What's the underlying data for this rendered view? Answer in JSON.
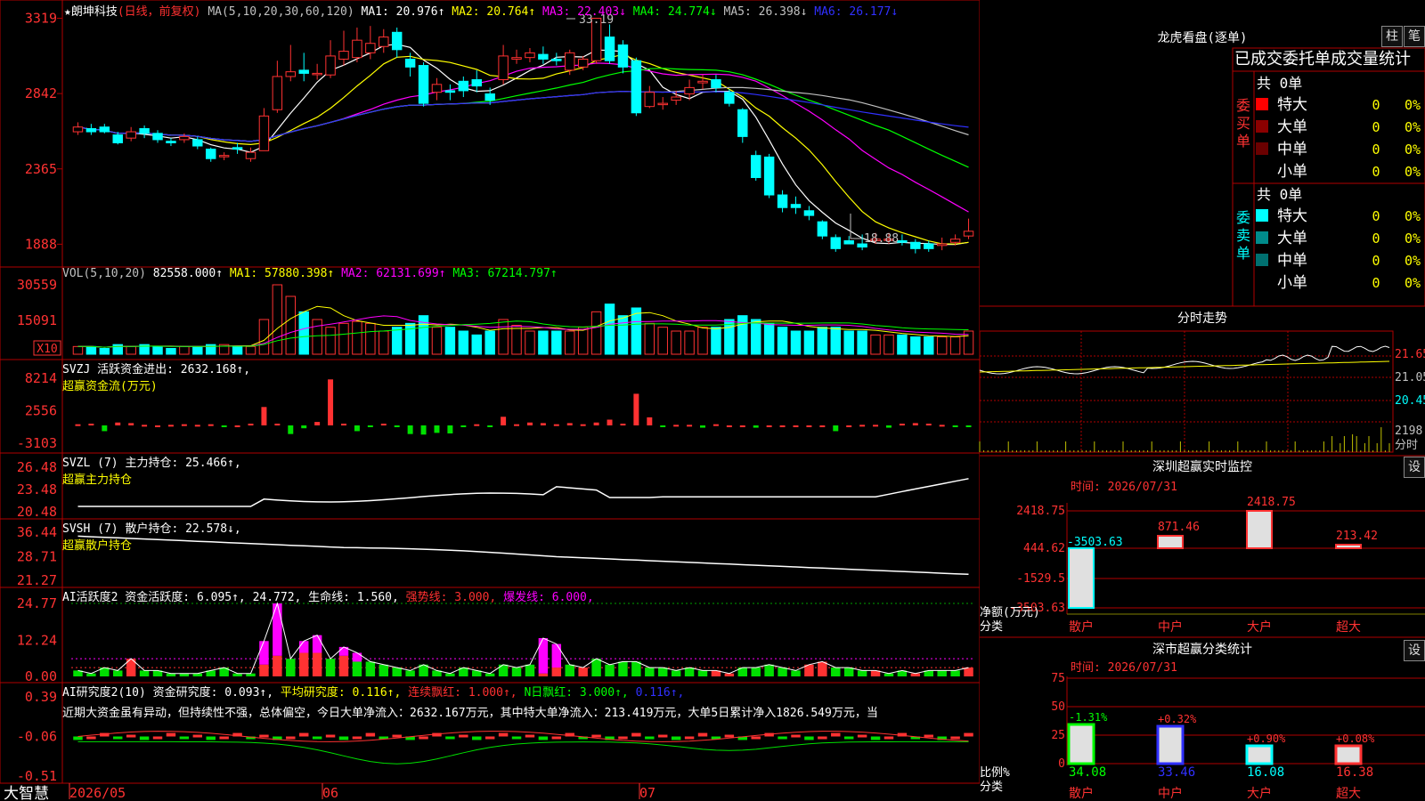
{
  "app": {
    "logo": "大智慧"
  },
  "stock_title": "★朗坤科技",
  "period": "(日线，前复权)",
  "main_ma": {
    "label": "MA(5,10,20,30,60,120)",
    "items": [
      {
        "text": "MA1: 20.976↑",
        "color": "#ffffff"
      },
      {
        "text": "MA2: 20.764↑",
        "color": "#ffff00"
      },
      {
        "text": "MA3: 22.403↓",
        "color": "#ff00ff"
      },
      {
        "text": "MA4: 24.774↓",
        "color": "#00ff00"
      },
      {
        "text": "MA5: 26.398↓",
        "color": "#c0c0c0"
      },
      {
        "text": "MA6: 26.177↓",
        "color": "#3030ff"
      }
    ]
  },
  "price_axis": [
    "3319",
    "2842",
    "2365",
    "1888"
  ],
  "annotations": {
    "high": "33.19",
    "low": "18.88"
  },
  "vol_panel": {
    "label": "VOL(5,10,20)",
    "value": "82558.000↑",
    "ma": [
      {
        "text": "MA1: 57880.398↑",
        "color": "#ffff00"
      },
      {
        "text": "MA2: 62131.699↑",
        "color": "#ff00ff"
      },
      {
        "text": "MA3: 67214.797↑",
        "color": "#00ff00"
      }
    ],
    "axis": [
      "30559",
      "15091"
    ],
    "unit": "X10"
  },
  "svzj_panel": {
    "label": "SVZJ  活跃资金进出: 2632.168↑,",
    "sub": "超赢资金流(万元)",
    "axis": [
      "8214",
      "2556",
      "-3103"
    ]
  },
  "svzl_panel": {
    "label": "SVZL (7) 主力持仓: 25.466↑,",
    "sub": "超赢主力持仓",
    "axis": [
      "26.48",
      "23.48",
      "20.48"
    ]
  },
  "svsh_panel": {
    "label": "SVSH (7) 散户持仓: 22.578↓,",
    "sub": "超赢散户持仓",
    "axis": [
      "36.44",
      "28.71",
      "21.27"
    ]
  },
  "ai_active_panel": {
    "label": "AI活跃度2 资金活跃度: 6.095↑, 24.772, 生命线: 1.560,",
    "strong": "强势线: 3.000,",
    "burst": "爆发线: 6.000,",
    "axis": [
      "24.77",
      "12.24",
      "0.00"
    ]
  },
  "ai_research_panel": {
    "label": "AI研究度2(10) 资金研究度: 0.093↑,",
    "avg": "平均研究度: 0.116↑,",
    "cont": "连续飘红: 1.000↑,",
    "nday": "N日飘红: 3.000↑,",
    "last": "0.116↑,",
    "comment": "近期大资金虽有异动，但持续性不强，总体偏空，今日大单净流入：2632.167万元，其中特大单净流入：213.419万元，大单5日累计净入1826.549万元，当",
    "axis": [
      "0.39",
      "-0.06",
      "-0.51"
    ]
  },
  "date_axis": [
    "2026/05",
    "06",
    "07"
  ],
  "right": {
    "dragon_title": "龙虎看盘(逐单)",
    "btn_bar": "柱",
    "btn_pen": "笔",
    "stats_header": "已成交委托单成交量统计",
    "buy_label": "委买单",
    "sell_label": "委卖单",
    "buy_total": "共 0单",
    "sell_total": "共 0单",
    "buy_rows": [
      {
        "name": "特大",
        "count": "0",
        "pct": "0%",
        "color": "#ff0000"
      },
      {
        "name": "大单",
        "count": "0",
        "pct": "0%",
        "color": "#8b0000"
      },
      {
        "name": "中单",
        "count": "0",
        "pct": "0%",
        "color": "#6b0000"
      },
      {
        "name": "小单",
        "count": "0",
        "pct": "0%",
        "color": ""
      }
    ],
    "sell_rows": [
      {
        "name": "特大",
        "count": "0",
        "pct": "0%",
        "color": "#00ffff"
      },
      {
        "name": "大单",
        "count": "0",
        "pct": "0%",
        "color": "#008b8b"
      },
      {
        "name": "中单",
        "count": "0",
        "pct": "0%",
        "color": "#007070"
      },
      {
        "name": "小单",
        "count": "0",
        "pct": "0%",
        "color": ""
      }
    ],
    "intraday_title": "分时走势",
    "intraday_axis": [
      "21.65",
      "21.05",
      "20.45"
    ],
    "intraday_vol": "2198",
    "intraday_vol_label": "分时",
    "sz_title": "深圳超赢实时监控",
    "sz_time": "时间: 2026/07/31",
    "sz_axis": [
      "2418.75",
      "444.62",
      "-1529.5",
      "-3503.63"
    ],
    "sz_bar_values": [
      "-3503.63",
      "871.46",
      "2418.75",
      "213.42"
    ],
    "sz_ylabel_1": "净额(万元)",
    "sz_ylabel_2": "分类",
    "sz_categories": [
      "散户",
      "中户",
      "大户",
      "超大"
    ],
    "sm_title": "深市超赢分类统计",
    "sm_time": "时间: 2026/07/31",
    "sm_axis": [
      "75",
      "50",
      "25",
      "0"
    ],
    "sm_changes": [
      "-1.31%",
      "+0.32%",
      "+0.90%",
      "+0.08%"
    ],
    "sm_values": [
      "34.08",
      "33.46",
      "16.08",
      "16.38"
    ],
    "sm_ylabel_1": "比例%",
    "sm_ylabel_2": "分类",
    "sm_categories": [
      "散户",
      "中户",
      "大户",
      "超大"
    ],
    "btn_settings": "设"
  },
  "chart_data": {
    "type": "candlestick",
    "price_scale": {
      "ylim": [
        18.0,
        33.5
      ]
    },
    "candles": [
      [
        26.0,
        26.3,
        26.6,
        25.8
      ],
      [
        26.2,
        26.0,
        26.5,
        25.8
      ],
      [
        26.3,
        26.0,
        26.5,
        25.9
      ],
      [
        25.8,
        25.3,
        26.0,
        25.2
      ],
      [
        25.6,
        26.0,
        26.3,
        25.4
      ],
      [
        26.2,
        25.9,
        26.4,
        25.6
      ],
      [
        25.9,
        25.5,
        26.1,
        25.3
      ],
      [
        25.4,
        25.3,
        25.6,
        25.1
      ],
      [
        25.5,
        25.7,
        25.9,
        25.3
      ],
      [
        25.5,
        25.1,
        25.7,
        24.9
      ],
      [
        24.9,
        24.3,
        25.0,
        24.1
      ],
      [
        24.5,
        24.5,
        24.7,
        24.2
      ],
      [
        25.0,
        24.9,
        25.3,
        24.6
      ],
      [
        24.3,
        24.7,
        25.0,
        24.1
      ],
      [
        24.8,
        27.0,
        27.5,
        24.8
      ],
      [
        27.4,
        29.5,
        30.5,
        27.2
      ],
      [
        29.5,
        29.8,
        31.5,
        29.2
      ],
      [
        29.9,
        29.7,
        31.0,
        29.2
      ],
      [
        29.7,
        29.7,
        30.3,
        29.3
      ],
      [
        29.6,
        30.8,
        31.8,
        29.4
      ],
      [
        30.6,
        31.1,
        32.4,
        30.2
      ],
      [
        30.7,
        31.8,
        32.6,
        30.4
      ],
      [
        31.0,
        31.6,
        32.7,
        30.6
      ],
      [
        31.4,
        32.0,
        32.5,
        31.0
      ],
      [
        32.3,
        31.2,
        32.6,
        30.7
      ],
      [
        30.6,
        30.1,
        31.0,
        29.5
      ],
      [
        30.2,
        27.8,
        30.4,
        27.6
      ],
      [
        28.5,
        29.0,
        29.4,
        28.0
      ],
      [
        28.6,
        28.5,
        29.0,
        28.0
      ],
      [
        29.2,
        28.6,
        29.5,
        28.2
      ],
      [
        29.3,
        28.9,
        29.9,
        28.5
      ],
      [
        28.4,
        28.0,
        28.8,
        27.7
      ],
      [
        29.3,
        30.8,
        31.5,
        29.0
      ],
      [
        30.6,
        30.7,
        31.2,
        30.3
      ],
      [
        30.7,
        31.0,
        31.3,
        30.4
      ],
      [
        30.9,
        30.6,
        31.4,
        30.3
      ],
      [
        30.6,
        30.5,
        31.0,
        30.2
      ],
      [
        29.9,
        31.0,
        31.2,
        29.6
      ],
      [
        30.1,
        30.6,
        30.8,
        29.9
      ],
      [
        30.5,
        33.19,
        33.19,
        30.3
      ],
      [
        32.0,
        30.5,
        32.8,
        30.3
      ],
      [
        31.5,
        30.1,
        31.8,
        29.7
      ],
      [
        30.5,
        27.2,
        30.7,
        27.0
      ],
      [
        27.6,
        28.5,
        28.9,
        27.5
      ],
      [
        27.8,
        27.8,
        28.2,
        27.4
      ],
      [
        28.0,
        28.2,
        28.6,
        27.7
      ],
      [
        28.4,
        28.8,
        29.3,
        28.0
      ],
      [
        29.1,
        29.2,
        29.6,
        28.7
      ],
      [
        29.3,
        28.8,
        29.6,
        28.5
      ],
      [
        28.5,
        27.8,
        28.7,
        27.6
      ],
      [
        27.4,
        25.7,
        27.5,
        25.3
      ],
      [
        24.5,
        23.1,
        24.8,
        22.9
      ],
      [
        24.4,
        22.0,
        24.6,
        21.8
      ],
      [
        22.0,
        21.2,
        22.3,
        20.9
      ],
      [
        21.4,
        21.2,
        21.9,
        20.8
      ],
      [
        21.0,
        20.7,
        21.3,
        20.4
      ],
      [
        20.3,
        19.4,
        20.4,
        19.2
      ],
      [
        19.3,
        18.6,
        19.5,
        18.4
      ],
      [
        19.1,
        18.9,
        19.4,
        18.88
      ],
      [
        18.9,
        18.7,
        19.5,
        18.5
      ],
      [
        19.1,
        19.2,
        19.6,
        18.9
      ],
      [
        19.2,
        19.2,
        19.6,
        18.9
      ],
      [
        19.1,
        19.0,
        19.5,
        18.8
      ],
      [
        19.0,
        18.6,
        19.2,
        18.3
      ],
      [
        18.9,
        18.6,
        19.1,
        18.4
      ],
      [
        18.8,
        18.9,
        19.3,
        18.5
      ],
      [
        19.0,
        19.2,
        19.5,
        18.8
      ],
      [
        19.4,
        19.7,
        20.5,
        19.2
      ]
    ]
  }
}
